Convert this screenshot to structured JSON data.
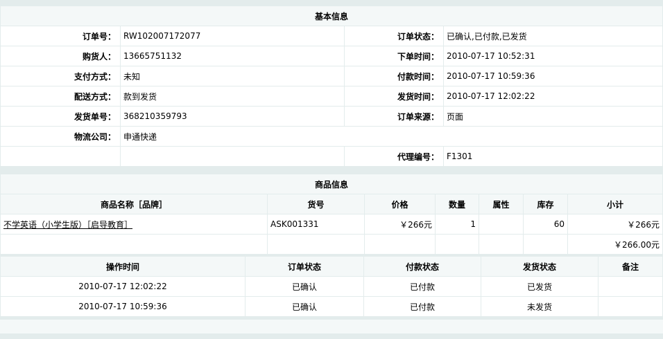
{
  "basic": {
    "title": "基本信息",
    "order_no_label": "订单号：",
    "order_no": "RW102007172077",
    "order_status_label": "订单状态：",
    "order_status": "已确认,已付款,已发货",
    "buyer_label": "购货人：",
    "buyer": "13665751132",
    "order_time_label": "下单时间：",
    "order_time": "2010-07-17 10:52:31",
    "pay_method_label": "支付方式：",
    "pay_method": "未知",
    "pay_time_label": "付款时间：",
    "pay_time": "2010-07-17 10:59:36",
    "ship_method_label": "配送方式：",
    "ship_method": "款到发货",
    "ship_time_label": "发货时间：",
    "ship_time": "2010-07-17 12:02:22",
    "ship_no_label": "发货单号：",
    "ship_no": "368210359793",
    "source_label": "订单来源：",
    "source": "页面",
    "logistics_label": "物流公司：",
    "logistics": "申通快递",
    "agent_label": "代理编号：",
    "agent": "F1301"
  },
  "goods": {
    "title": "商品信息",
    "headers": [
      "商品名称［品牌］",
      "货号",
      "价格",
      "数量",
      "属性",
      "库存",
      "小计"
    ],
    "rows": [
      {
        "name": "不学英语（小学生版）［启导教育］",
        "sku": "ASK001331",
        "price": "￥266元",
        "qty": "1",
        "attr": "",
        "stock": "60",
        "subtotal": "￥266元"
      }
    ],
    "total": "￥266.00元"
  },
  "log": {
    "headers": [
      "操作时间",
      "订单状态",
      "付款状态",
      "发货状态",
      "备注"
    ],
    "rows": [
      {
        "time": "2010-07-17 12:02:22",
        "order": "已确认",
        "pay": "已付款",
        "ship": "已发货",
        "note": ""
      },
      {
        "time": "2010-07-17 10:59:36",
        "order": "已确认",
        "pay": "已付款",
        "ship": "未发货",
        "note": ""
      }
    ]
  }
}
